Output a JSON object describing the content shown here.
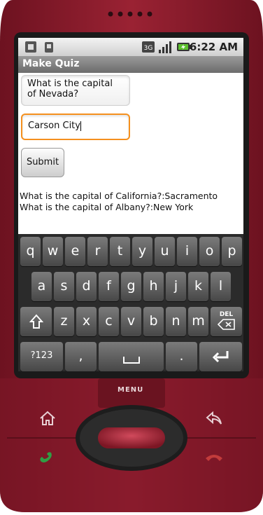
{
  "status_bar": {
    "time": "6:22 AM"
  },
  "app": {
    "title": "Make Quiz"
  },
  "form": {
    "question_value": "What is the capital of Nevada?",
    "answer_value": "Carson City",
    "submit_label": "Submit"
  },
  "output": {
    "lines": [
      "What is the capital of California?:Sacramento",
      "What is the capital of Albany?:New York"
    ]
  },
  "keyboard": {
    "row1": [
      "q",
      "w",
      "e",
      "r",
      "t",
      "y",
      "u",
      "i",
      "o",
      "p"
    ],
    "row2": [
      "a",
      "s",
      "d",
      "f",
      "g",
      "h",
      "j",
      "k",
      "l"
    ],
    "row3": [
      "z",
      "x",
      "c",
      "v",
      "b",
      "n",
      "m"
    ],
    "del_label": "DEL",
    "symbols_label": "?123",
    "comma_label": ",",
    "period_label": "."
  },
  "device": {
    "menu_label": "MENU"
  },
  "colors": {
    "phone_body": "#8b1d2c",
    "focus_border": "#f5901e",
    "call_green": "#2f9e44",
    "end_red": "#c23b3b"
  }
}
